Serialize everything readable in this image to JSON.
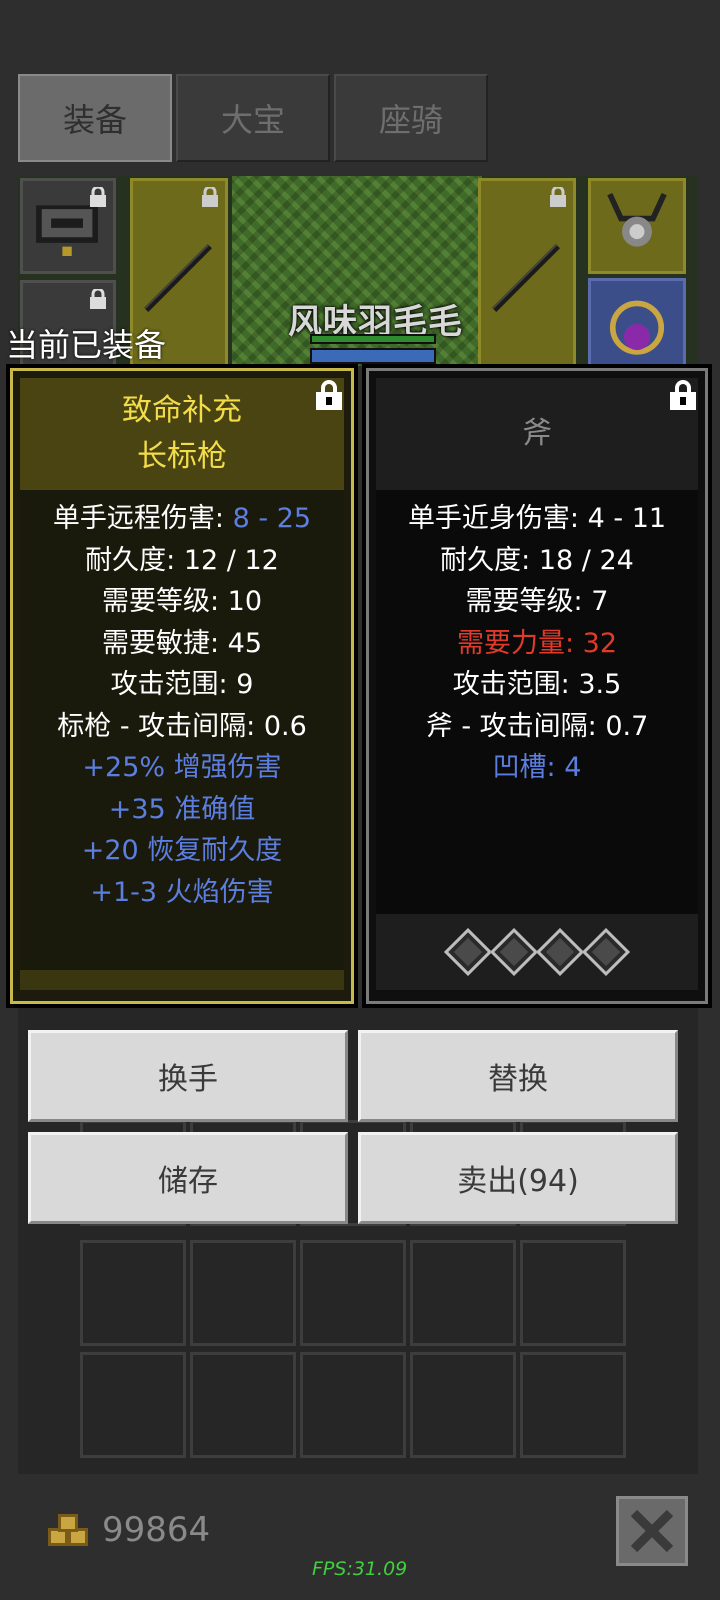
{
  "tabs": [
    {
      "label": "装备",
      "active": true
    },
    {
      "label": "大宝",
      "active": false
    },
    {
      "label": "座骑",
      "active": false
    }
  ],
  "scene": {
    "hero_name": "风味羽毛毛"
  },
  "equipped_label": "当前已装备",
  "left_item": {
    "title_line1": "致命补充",
    "title_line2": "长标枪",
    "damage_label": "单手远程伤害: ",
    "damage_value": "8 - 25",
    "durability": "耐久度: 12 / 12",
    "req_level": "需要等级: 10",
    "req_dex": "需要敏捷: 45",
    "range": "攻击范围: 9",
    "speed": "标枪 - 攻击间隔: 0.6",
    "mods": [
      "+25% 增强伤害",
      "+35 准确值",
      "+20 恢复耐久度",
      "+1-3 火焰伤害"
    ],
    "frame_color": "#c9b84a"
  },
  "right_item": {
    "title": "斧",
    "damage": "单手近身伤害: 4 - 11",
    "durability": "耐久度: 18 / 24",
    "req_level": "需要等级: 7",
    "req_str": "需要力量: 32",
    "range": "攻击范围: 3.5",
    "speed": "斧 - 攻击间隔: 0.7",
    "sockets_text": "凹槽: 4",
    "socket_count": 4,
    "unmet_color": "#e03a2a"
  },
  "buttons": {
    "swap_hand": "换手",
    "replace": "替换",
    "store": "储存",
    "sell": "卖出(94)"
  },
  "footer": {
    "gold": "99864",
    "fps": "FPS:31.09"
  },
  "icons": [
    "lock-icon",
    "coin-icon",
    "close-icon",
    "socket-icon",
    "spear-icon"
  ],
  "colors": {
    "magic_blue": "#5c7ee0",
    "unique_gold": "#f2dc4a",
    "fps_green": "#3fcf3f"
  }
}
